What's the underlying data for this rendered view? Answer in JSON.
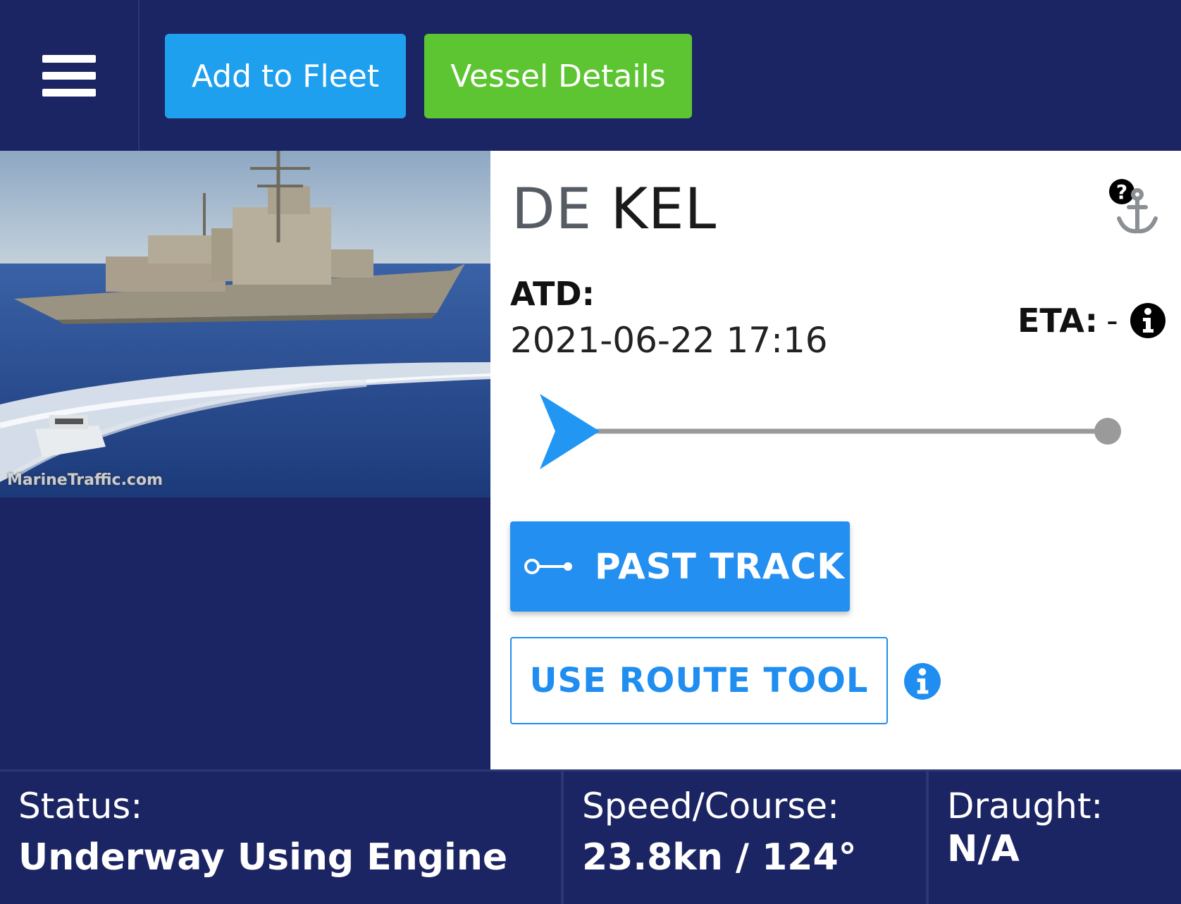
{
  "toolbar": {
    "menu_icon": "hamburger-menu-icon",
    "add_to_fleet_label": "Add to Fleet",
    "vessel_details_label": "Vessel Details",
    "colors": {
      "background": "#1c2563",
      "add_to_fleet": "#1fa0ee",
      "vessel_details": "#5cc531"
    }
  },
  "photo": {
    "credit": "MarineTraffic.com"
  },
  "vessel": {
    "flag_code": "DE",
    "name": "KEL",
    "status_icon": "anchor-question-icon"
  },
  "voyage": {
    "atd_label": "ATD:",
    "atd_value": "2021-06-22 17:16",
    "eta_label": "ETA:",
    "eta_value": "-",
    "eta_info_icon": "info-icon",
    "progress": 0.0
  },
  "actions": {
    "past_track_label": "PAST TRACK",
    "past_track_icon": "track-icon",
    "route_tool_label": "USE ROUTE TOOL",
    "route_tool_info_icon": "info-icon",
    "colors": {
      "primary": "#238ff0"
    }
  },
  "stats": {
    "status": {
      "label": "Status:",
      "value": "Underway Using Engine"
    },
    "speed_course": {
      "label": "Speed/Course:",
      "value": "23.8kn / 124°"
    },
    "draught": {
      "label": "Draught:",
      "value": "N/A"
    }
  }
}
